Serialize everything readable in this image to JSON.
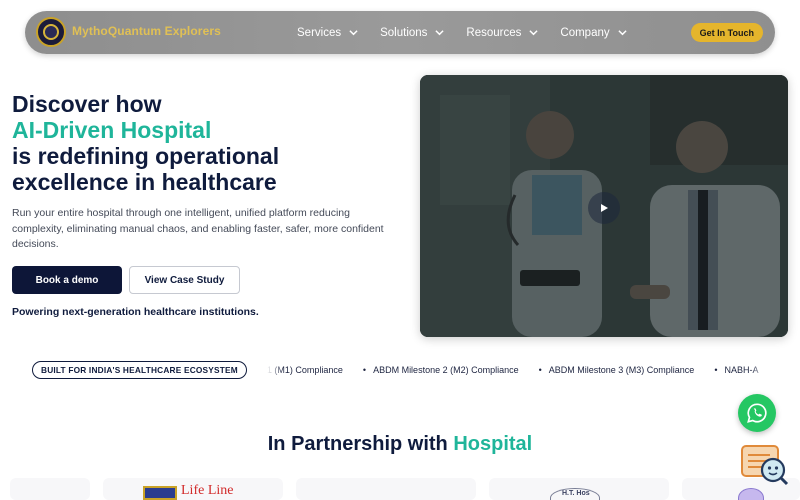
{
  "nav": {
    "brand": "MythoQuantum Explorers",
    "items": [
      {
        "label": "Services"
      },
      {
        "label": "Solutions"
      },
      {
        "label": "Resources"
      },
      {
        "label": "Company"
      }
    ],
    "cta": "Get In Touch"
  },
  "hero": {
    "title_line1": "Discover how",
    "title_accent": "AI-Driven Hospital",
    "title_line3": "is redefining operational",
    "title_line4": "excellence in healthcare",
    "description": "Run your entire hospital through one intelligent, unified platform reducing complexity, eliminating manual chaos, and enabling faster, safer, more confident decisions.",
    "primary_button": "Book a demo",
    "secondary_button": "View Case Study",
    "powering": "Powering next-generation healthcare institutions."
  },
  "video": {
    "play_icon": "play-icon"
  },
  "ticker": {
    "pill": "BUILT FOR INDIA'S HEALTHCARE ECOSYSTEM",
    "items": [
      "1 (M1) Compliance",
      "ABDM Milestone 2 (M2) Compliance",
      "ABDM Milestone 3 (M3) Compliance",
      "NABH-A"
    ],
    "bullet": "•"
  },
  "partners": {
    "title_prefix": "In Partnership with ",
    "title_accent": "Hospital",
    "logo1_text": "Life Line",
    "logo2_text": "H.T. Hos"
  },
  "floating": {
    "whatsapp_icon": "whatsapp-icon",
    "chat_icon": "chatbot-icon"
  },
  "colors": {
    "accent": "#1fb59a",
    "navy": "#0f1b3d",
    "cta": "#e5b52c",
    "whatsapp": "#25c763"
  }
}
